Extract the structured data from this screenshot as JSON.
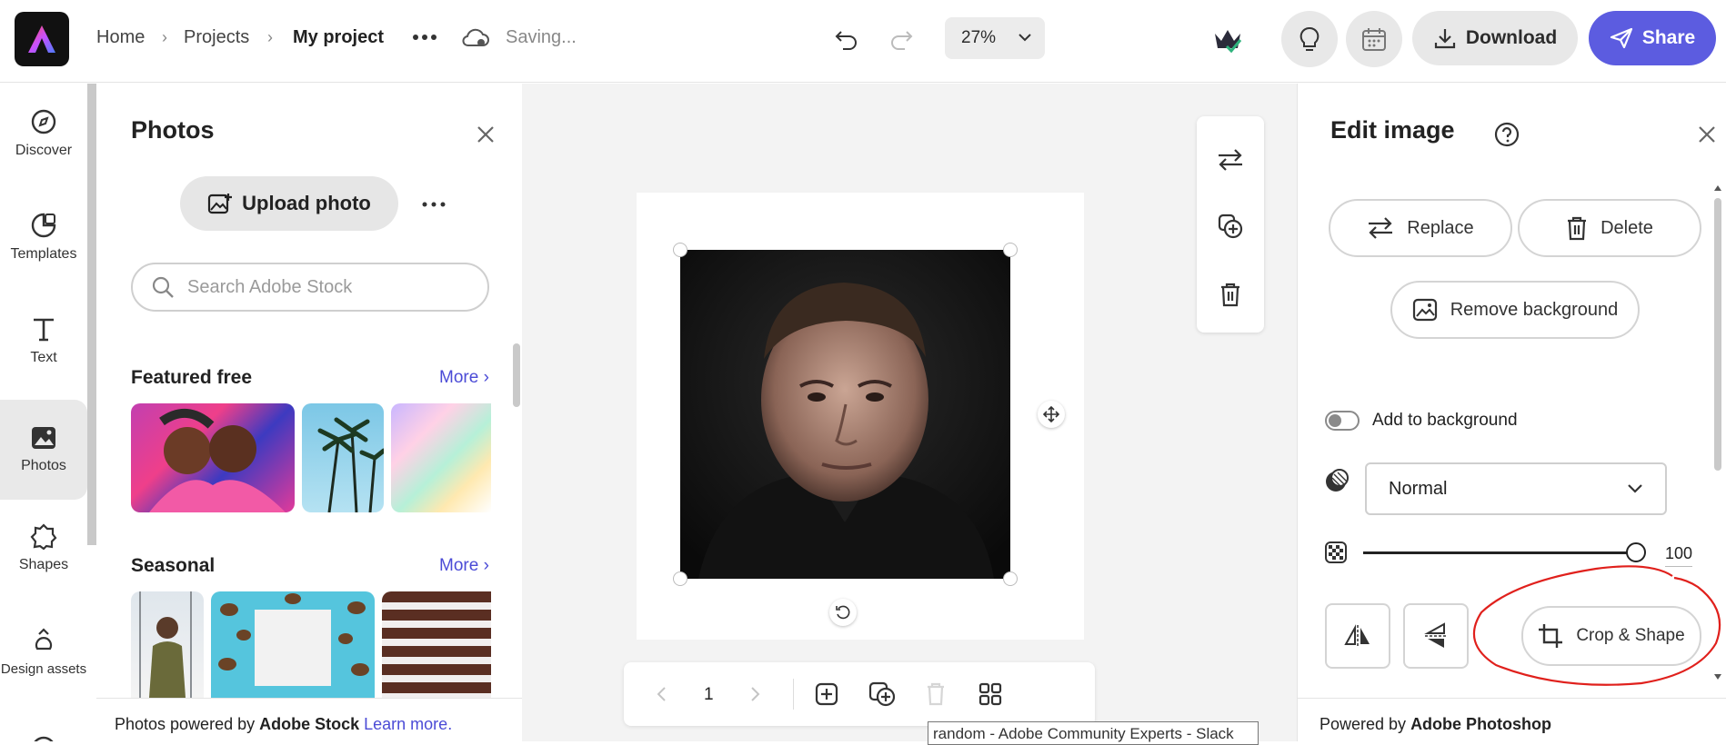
{
  "header": {
    "breadcrumb": [
      "Home",
      "Projects",
      "My project"
    ],
    "status": "Saving...",
    "zoom": "27%",
    "download_label": "Download",
    "share_label": "Share"
  },
  "rail": [
    {
      "label": "Discover",
      "icon": "compass-icon"
    },
    {
      "label": "Templates",
      "icon": "templates-icon"
    },
    {
      "label": "Text",
      "icon": "text-icon"
    },
    {
      "label": "Photos",
      "icon": "photos-icon",
      "active": true
    },
    {
      "label": "Shapes",
      "icon": "shapes-icon"
    },
    {
      "label": "Design assets",
      "icon": "design-assets-icon"
    }
  ],
  "photos_panel": {
    "title": "Photos",
    "upload_label": "Upload photo",
    "search_placeholder": "Search Adobe Stock",
    "sections": [
      {
        "title": "Featured free",
        "more": "More"
      },
      {
        "title": "Seasonal",
        "more": "More"
      }
    ],
    "footer_text": "Photos powered by ",
    "footer_brand": "Adobe Stock",
    "footer_link": "Learn more."
  },
  "canvas": {
    "page_number": "1",
    "tooltip": "random - Adobe Community Experts - Slack"
  },
  "edit_panel": {
    "title": "Edit image",
    "replace_label": "Replace",
    "delete_label": "Delete",
    "remove_bg_label": "Remove background",
    "add_to_bg_label": "Add to background",
    "blend_mode": "Normal",
    "opacity": "100",
    "crop_label": "Crop & Shape",
    "footer_text": "Powered by ",
    "footer_brand": "Adobe Photoshop"
  },
  "colors": {
    "accent": "#5c5ce0",
    "link": "#4b4bd6",
    "annotation": "#e0201c"
  }
}
